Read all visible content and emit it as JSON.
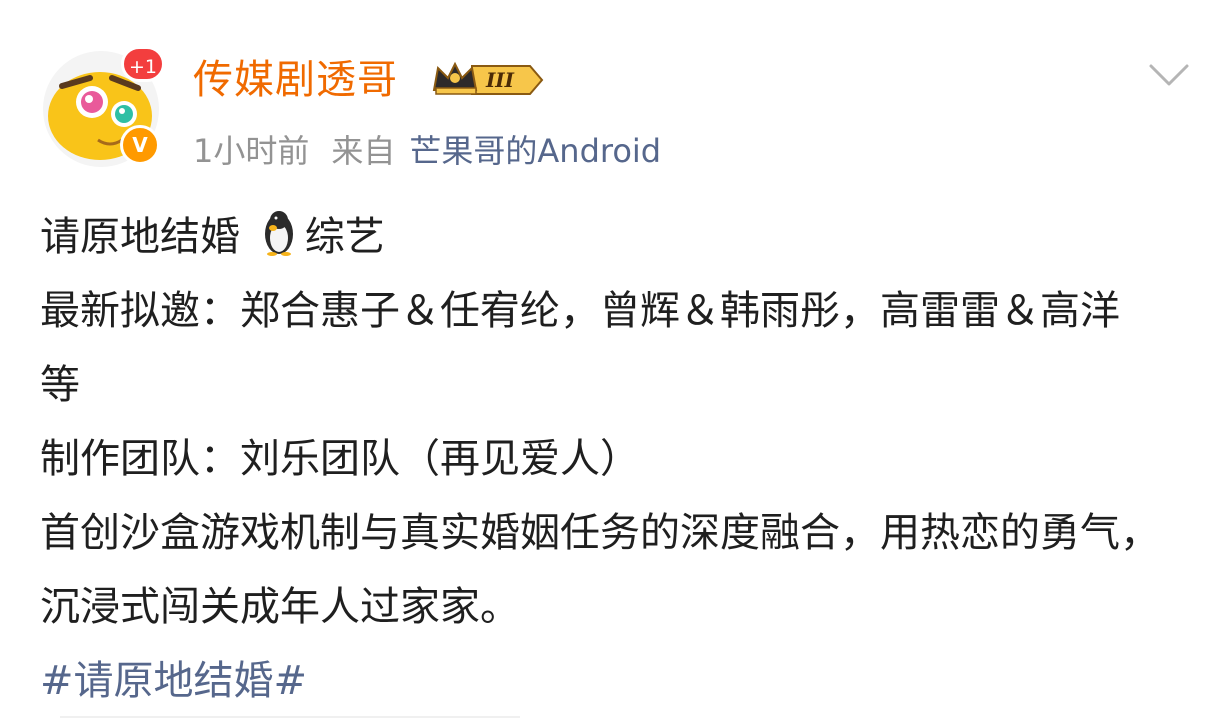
{
  "post": {
    "badge_count": "+1",
    "verified_mark": "V",
    "username": "传媒剧透哥",
    "vip_level": "III",
    "time_ago": "1小时前",
    "from_label": "来自",
    "device": "芒果哥的Android",
    "lines": [
      "请原地结婚",
      "综艺",
      "最新拟邀：郑合惠子＆任宥纶，曾辉＆韩雨彤，高雷雷＆高洋 等",
      "制作团队：刘乐团队（再见爱人）",
      "首创沙盒游戏机制与真实婚姻任务的深度融合，用热恋的勇气，沉浸式闯关成年人过家家。"
    ],
    "hashtag": "#请原地结婚#"
  },
  "icons": {
    "avatar": "cartoon-face-avatar",
    "vip": "crown-vip-badge-icon",
    "menu": "chevron-down-icon",
    "emoji": "penguin-emoji-icon"
  },
  "colors": {
    "username": "#f06a00",
    "link": "#56678c",
    "meta": "#939393",
    "badge": "#f33e3e",
    "verified": "#ff9a00"
  }
}
